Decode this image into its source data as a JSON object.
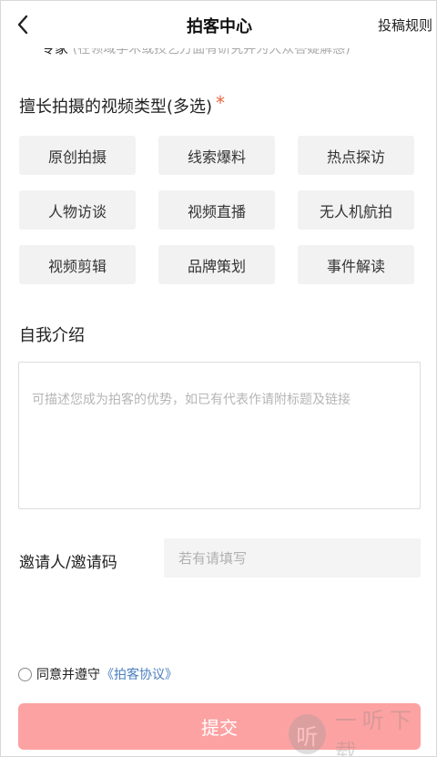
{
  "header": {
    "title": "拍客中心",
    "rules_link": "投稿规则"
  },
  "prev_option": {
    "label": "专家",
    "hint": "(在领域学术或技艺方面有研究并为大众答疑解惑)"
  },
  "video_types": {
    "title": "擅长拍摄的视频类型(多选)",
    "required_mark": "*",
    "options": [
      "原创拍摄",
      "线索爆料",
      "热点探访",
      "人物访谈",
      "视频直播",
      "无人机航拍",
      "视频剪辑",
      "品牌策划",
      "事件解读"
    ]
  },
  "intro": {
    "title": "自我介绍",
    "placeholder": "可描述您成为拍客的优势，如已有代表作请附标题及链接",
    "value": ""
  },
  "invite": {
    "label": "邀请人/邀请码",
    "placeholder": "若有请填写",
    "value": ""
  },
  "agreement": {
    "text": "同意并遵守",
    "link": "《拍客协议》",
    "checked": false
  },
  "submit": {
    "label": "提交"
  },
  "watermark": {
    "logo_char": "听",
    "text": "一听下载"
  },
  "colors": {
    "required": "#f0643c",
    "link": "#4a7fbf",
    "submit_bg": "#fda2a2",
    "tag_bg": "#f2f2f2"
  }
}
